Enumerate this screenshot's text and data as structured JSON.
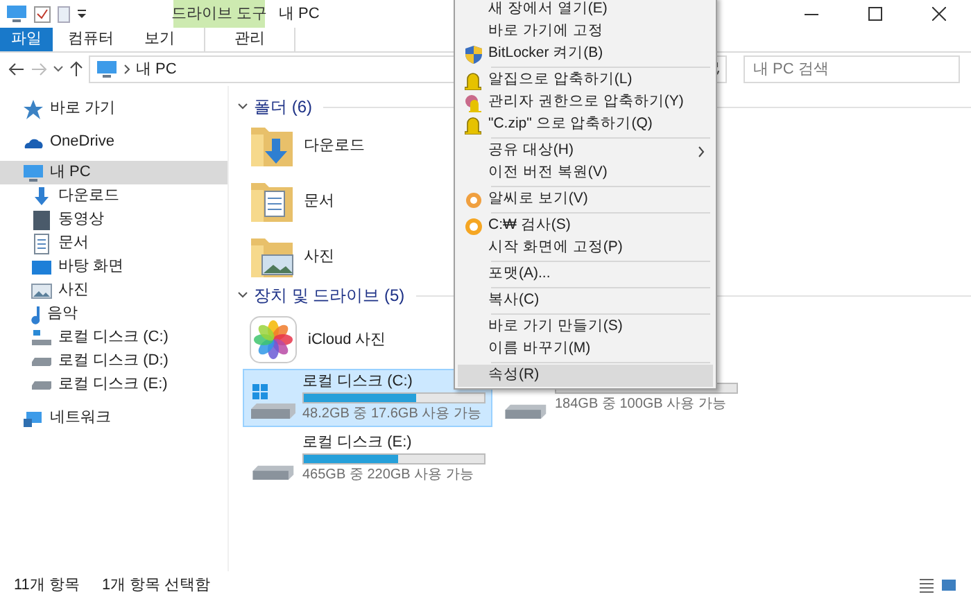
{
  "window": {
    "title": "내 PC"
  },
  "ribbon": {
    "context_header": "드라이브 도구",
    "tabs": [
      {
        "label": "파일",
        "kind": "file",
        "selected": false
      },
      {
        "label": "컴퓨터",
        "kind": "tab",
        "selected": false
      },
      {
        "label": "보기",
        "kind": "tab",
        "selected": false
      },
      {
        "label": "관리",
        "kind": "context",
        "selected": false
      }
    ]
  },
  "address_bar": {
    "path": "내 PC",
    "search_placeholder": "내 PC 검색"
  },
  "sidebar": {
    "items": [
      {
        "label": "바로 가기",
        "kind": "star",
        "selected": false
      },
      {
        "label": "OneDrive",
        "kind": "cloud",
        "selected": false
      },
      {
        "label": "내 PC",
        "kind": "pc",
        "selected": true,
        "children": [
          {
            "label": "다운로드",
            "kind": "download",
            "selected": false
          },
          {
            "label": "동영상",
            "kind": "video",
            "selected": false
          },
          {
            "label": "문서",
            "kind": "document",
            "selected": false
          },
          {
            "label": "바탕 화면",
            "kind": "desktop",
            "selected": false
          },
          {
            "label": "사진",
            "kind": "picture",
            "selected": false
          },
          {
            "label": "음악",
            "kind": "music",
            "selected": false
          },
          {
            "label": "로컬 디스크 (C:)",
            "kind": "sysdrive",
            "selected": false
          },
          {
            "label": "로컬 디스크 (D:)",
            "kind": "drive",
            "selected": false
          },
          {
            "label": "로컬 디스크 (E:)",
            "kind": "drive",
            "selected": false
          }
        ]
      },
      {
        "label": "네트워크",
        "kind": "network",
        "selected": false
      }
    ]
  },
  "sections": [
    {
      "title": "폴더 (6)",
      "expanded": true,
      "kind": "folders",
      "items": [
        {
          "label": "다운로드",
          "kind": "download"
        },
        {
          "label": "문서",
          "kind": "document"
        },
        {
          "label": "사진",
          "kind": "picture"
        }
      ]
    },
    {
      "title": "장치 및 드라이브 (5)",
      "expanded": true,
      "kind": "drives",
      "items": [
        {
          "kind": "app",
          "label": "iCloud 사진",
          "selected": false
        },
        {
          "kind": "drive",
          "label": "로컬 디스크 (C:)",
          "system": true,
          "level": 0.62,
          "free": "48.2GB 중 17.6GB 사용 가능",
          "selected": true
        },
        {
          "kind": "covered_drive",
          "free": "184GB 중 100GB 사용 가능",
          "selected": false
        },
        {
          "kind": "drive",
          "label": "로컬 디스크 (E:)",
          "system": false,
          "level": 0.52,
          "free": "465GB 중 220GB 사용 가능",
          "selected": false
        }
      ]
    }
  ],
  "context_menu": {
    "groups": [
      [
        {
          "label": "새 장에서 열기(E)",
          "highlighted": false
        },
        {
          "label": "바로 가기에 고정",
          "highlighted": false
        },
        {
          "label": "BitLocker 켜기(B)",
          "kind": "shield",
          "highlighted": false
        }
      ],
      [
        {
          "label": "알집으로 압축하기(L)",
          "kind": "zip",
          "highlighted": false
        },
        {
          "label": "관리자 권한으로 압축하기(Y)",
          "kind": "zip-admin",
          "highlighted": false
        },
        {
          "label": "\"C.zip\" 으로 압축하기(Q)",
          "kind": "zip",
          "highlighted": false
        }
      ],
      [
        {
          "label": "공유 대상(H)",
          "submenu": true,
          "highlighted": false
        },
        {
          "label": "이전 버전 복원(V)",
          "highlighted": false
        }
      ],
      [
        {
          "label": "알씨로 보기(V)",
          "kind": "viewer",
          "highlighted": false
        }
      ],
      [
        {
          "label": "C:₩ 검사(S)",
          "kind": "scan",
          "highlighted": false
        },
        {
          "label": "시작 화면에 고정(P)",
          "highlighted": false
        }
      ],
      [
        {
          "label": "포맷(A)...",
          "highlighted": false
        }
      ],
      [
        {
          "label": "복사(C)",
          "highlighted": false
        }
      ],
      [
        {
          "label": "바로 가기 만들기(S)",
          "highlighted": false
        },
        {
          "label": "이름 바꾸기(M)",
          "highlighted": false
        }
      ],
      [
        {
          "label": "속성(R)",
          "highlighted": true
        }
      ]
    ]
  },
  "status_bar": {
    "items": "11개 항목",
    "selection": "1개 항목 선택함"
  }
}
